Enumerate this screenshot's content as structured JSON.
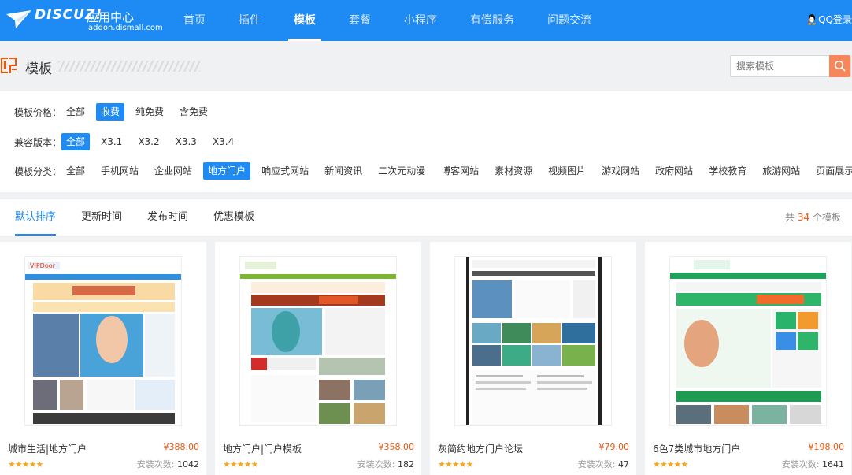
{
  "header": {
    "logo_text": "DISCUZ!",
    "logo_sub": "应用中心",
    "logo_url": "addon.dismall.com",
    "nav": [
      {
        "label": "首页",
        "active": false
      },
      {
        "label": "插件",
        "active": false
      },
      {
        "label": "模板",
        "active": true
      },
      {
        "label": "套餐",
        "active": false
      },
      {
        "label": "小程序",
        "active": false
      },
      {
        "label": "有偿服务",
        "active": false
      },
      {
        "label": "问题交流",
        "active": false
      }
    ],
    "login_label": "QQ登录"
  },
  "page": {
    "title": "模板",
    "search_placeholder": "搜索模板"
  },
  "filters": {
    "price": {
      "label": "模板价格：",
      "options": [
        "全部",
        "收费",
        "纯免费",
        "含免费"
      ],
      "active": 1
    },
    "version": {
      "label": "兼容版本：",
      "options": [
        "全部",
        "X3.1",
        "X3.2",
        "X3.3",
        "X3.4"
      ],
      "active": 0
    },
    "category": {
      "label": "模板分类：",
      "options": [
        "全部",
        "手机网站",
        "企业网站",
        "地方门户",
        "响应式网站",
        "新闻资讯",
        "二次元动漫",
        "博客网站",
        "素材资源",
        "视频图片",
        "游戏网站",
        "政府网站",
        "学校教育",
        "旅游网站",
        "页面展示"
      ],
      "active": 3
    }
  },
  "sort": {
    "tabs": [
      "默认排序",
      "更新时间",
      "发布时间",
      "优惠模板"
    ],
    "active": 0,
    "total_prefix": "共",
    "total_count": "34",
    "total_suffix": "个模板"
  },
  "cards": [
    {
      "name": "城市生活|地方门户",
      "price": "¥388.00",
      "installs_label": "安装次数:",
      "installs": "1042",
      "stars": "★★★★★"
    },
    {
      "name": "地方门户|门户模板",
      "price": "¥358.00",
      "installs_label": "安装次数:",
      "installs": "182",
      "stars": "★★★★★"
    },
    {
      "name": "灰简约地方门户论坛",
      "price": "¥79.00",
      "installs_label": "安装次数:",
      "installs": "47",
      "stars": "★★★★★"
    },
    {
      "name": "6色7类城市地方门户",
      "price": "¥198.00",
      "installs_label": "安装次数:",
      "installs": "1641",
      "stars": "★★★★★"
    }
  ],
  "colors": {
    "brand": "#1e8bf4",
    "accent": "#f2550a",
    "search_button": "#f7875a",
    "star": "#f5a623"
  }
}
